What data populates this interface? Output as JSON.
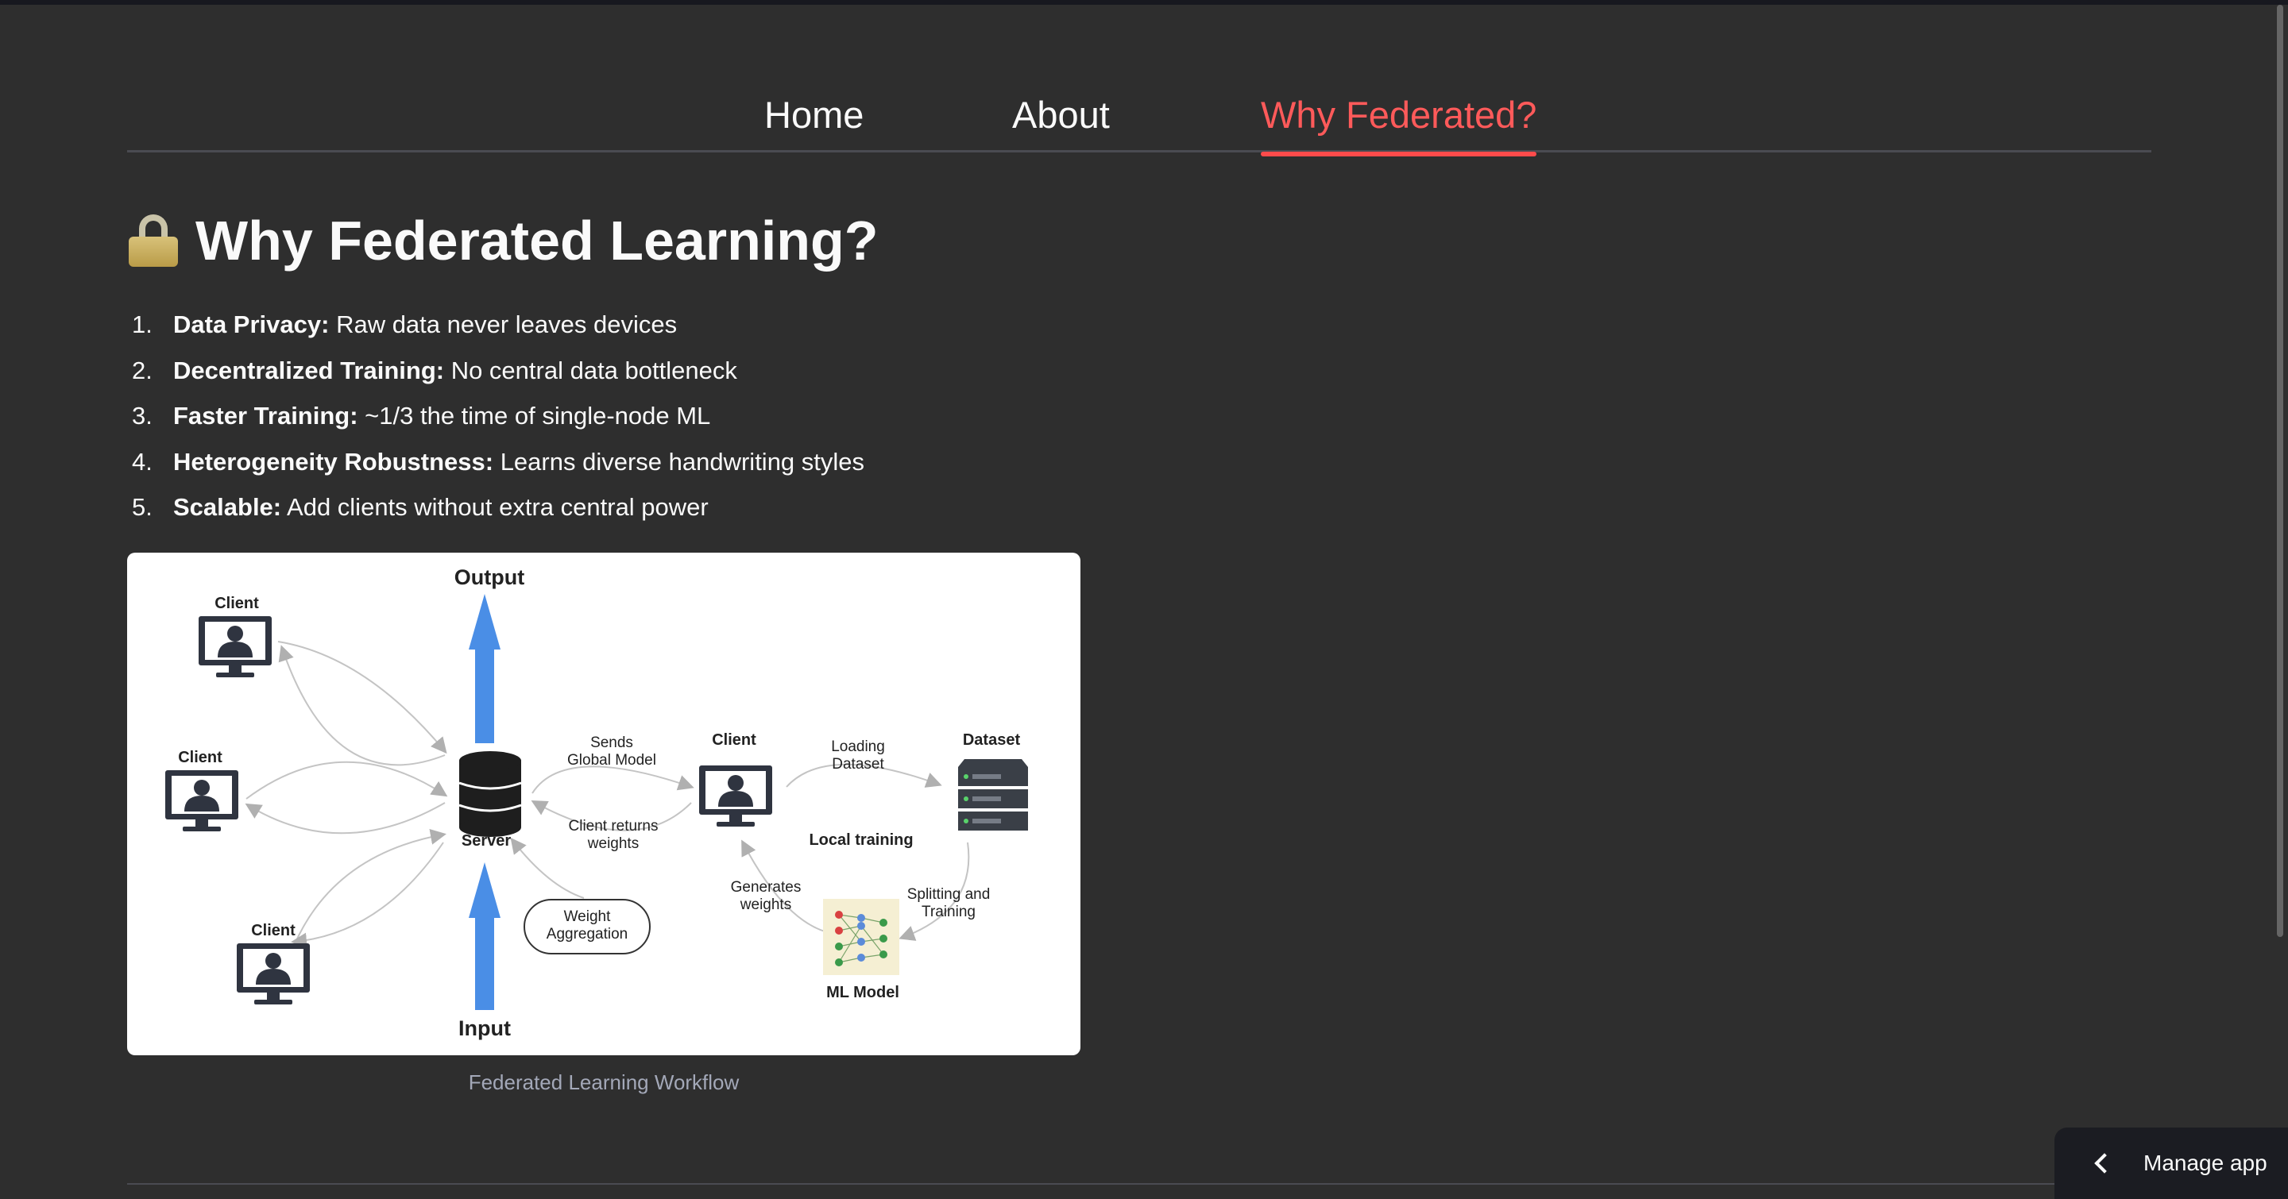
{
  "nav": {
    "tabs": [
      {
        "label": "Home",
        "active": false
      },
      {
        "label": "About",
        "active": false
      },
      {
        "label": "Why Federated?",
        "active": true
      }
    ]
  },
  "page": {
    "title": "Why Federated Learning?",
    "title_icon": "lock-icon",
    "benefits": [
      {
        "num": "1.",
        "term": "Data Privacy:",
        "text": " Raw data never leaves devices"
      },
      {
        "num": "2.",
        "term": "Decentralized Training:",
        "text": " No central data bottleneck"
      },
      {
        "num": "3.",
        "term": "Faster Training:",
        "text": " ~1/3 the time of single-node ML"
      },
      {
        "num": "4.",
        "term": "Heterogeneity Robustness:",
        "text": " Learns diverse handwriting styles"
      },
      {
        "num": "5.",
        "term": "Scalable:",
        "text": " Add clients without extra central power"
      }
    ]
  },
  "diagram": {
    "output": "Output",
    "input": "Input",
    "client": "Client",
    "server": "Server",
    "sends_global_model": [
      "Sends",
      "Global Model"
    ],
    "client_returns_weights": [
      "Client returns",
      "weights"
    ],
    "weight_aggregation": [
      "Weight",
      "Aggregation"
    ],
    "loading_dataset": [
      "Loading",
      "Dataset"
    ],
    "dataset": "Dataset",
    "local_training": "Local training",
    "generates_weights": [
      "Generates",
      "weights"
    ],
    "splitting_training": [
      "Splitting and",
      "Training"
    ],
    "ml_model": "ML Model",
    "colors": {
      "arrow": "#4a8ee6",
      "icon": "#2f3440",
      "curve": "#b8b8b8"
    }
  },
  "caption": "Federated Learning Workflow",
  "manage_app": {
    "label": "Manage app"
  }
}
